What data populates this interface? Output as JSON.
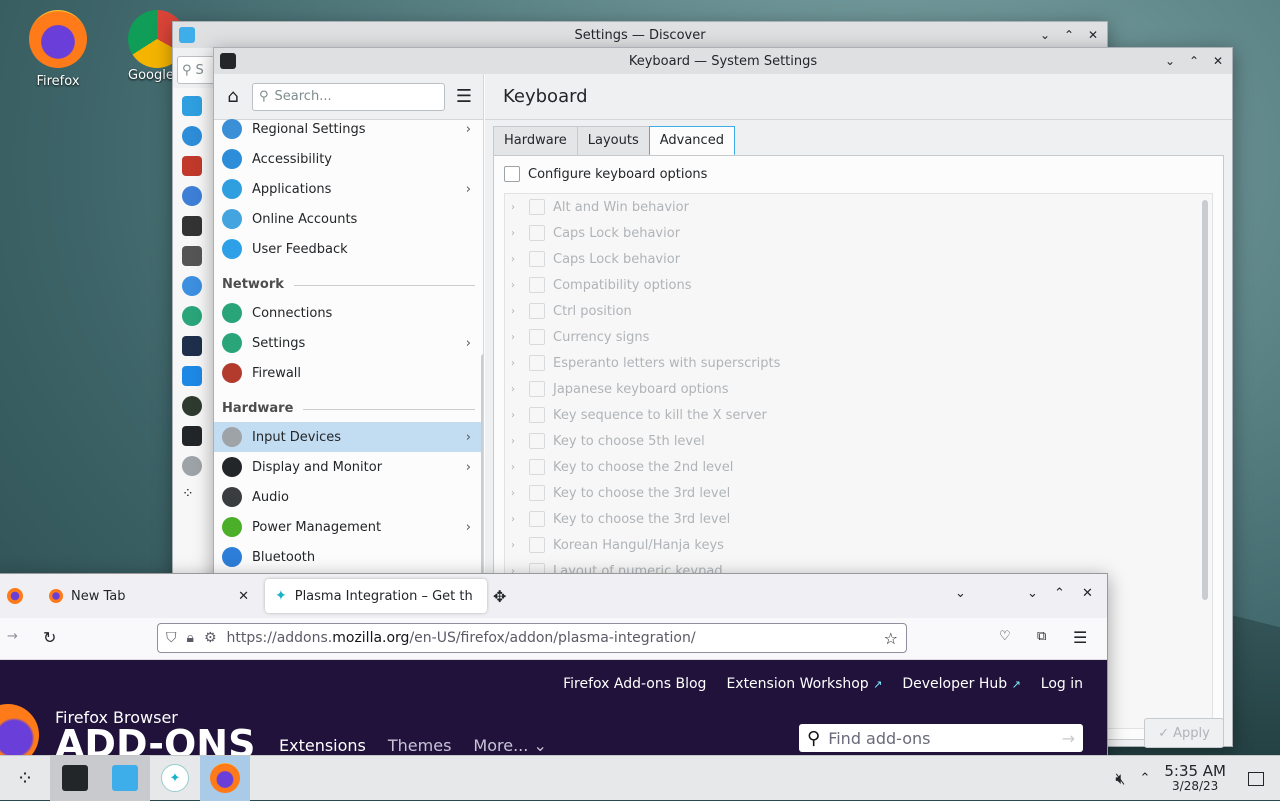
{
  "desktop": {
    "icons": [
      {
        "label": "Firefox"
      },
      {
        "label": "Google"
      }
    ]
  },
  "discover": {
    "title": "Settings — Discover",
    "search_partial": "S"
  },
  "system_settings": {
    "title": "Keyboard — System Settings",
    "search_placeholder": "Search...",
    "page_title": "Keyboard",
    "categories_top": [
      {
        "label": "Regional Settings",
        "chev": true,
        "color": "#3b8fd6"
      },
      {
        "label": "Accessibility",
        "chev": false,
        "color": "#2d8dd8"
      },
      {
        "label": "Applications",
        "chev": true,
        "color": "#2f9fe0"
      },
      {
        "label": "Online Accounts",
        "chev": false,
        "color": "#43a4df"
      },
      {
        "label": "User Feedback",
        "chev": false,
        "color": "#2ea0e8"
      }
    ],
    "section_network": "Network",
    "categories_network": [
      {
        "label": "Connections",
        "chev": false,
        "color": "#2aa57a"
      },
      {
        "label": "Settings",
        "chev": true,
        "color": "#2aa57a"
      },
      {
        "label": "Firewall",
        "chev": false,
        "color": "#b23b2e"
      }
    ],
    "section_hardware": "Hardware",
    "categories_hardware": [
      {
        "label": "Input Devices",
        "chev": true,
        "color": "#9ea3a8"
      },
      {
        "label": "Display and Monitor",
        "chev": true,
        "color": "#232629"
      },
      {
        "label": "Audio",
        "chev": false,
        "color": "#3a3d40"
      },
      {
        "label": "Power Management",
        "chev": true,
        "color": "#4caf2a"
      },
      {
        "label": "Bluetooth",
        "chev": false,
        "color": "#2d7ed8"
      }
    ],
    "tabs": [
      "Hardware",
      "Layouts",
      "Advanced"
    ],
    "configure_label": "Configure keyboard options",
    "options": [
      "Alt and Win behavior",
      "Caps Lock behavior",
      "Caps Lock behavior",
      "Compatibility options",
      "Ctrl position",
      "Currency signs",
      "Esperanto letters with superscripts",
      "Japanese keyboard options",
      "Key sequence to kill the X server",
      "Key to choose 5th level",
      "Key to choose the 2nd level",
      "Key to choose the 3rd level",
      "Key to choose the 3rd level",
      "Korean Hangul/Hanja keys",
      "Layout of numeric keypad"
    ],
    "apply_label": "Apply"
  },
  "firefox": {
    "tabs": [
      {
        "label": "New Tab"
      },
      {
        "label": "Plasma Integration – Get th"
      }
    ],
    "url_pre": "https://addons.",
    "url_domain": "mozilla.org",
    "url_post": "/en-US/firefox/addon/plasma-integration/",
    "top_links": [
      "Firefox Add-ons Blog",
      "Extension Workshop",
      "Developer Hub",
      "Log in"
    ],
    "ext_marks": [
      "↗",
      "↗"
    ],
    "brand_top": "Firefox Browser",
    "brand_main": "ADD-ONS",
    "nav": [
      "Extensions",
      "Themes",
      "More..."
    ],
    "find_placeholder": "Find add-ons"
  },
  "taskbar": {
    "time": "5:35 AM",
    "date": "3/28/23"
  },
  "colors": {
    "accent": "#3daee9",
    "selection": "#c2dcf2",
    "amo_bg": "#20123a"
  }
}
